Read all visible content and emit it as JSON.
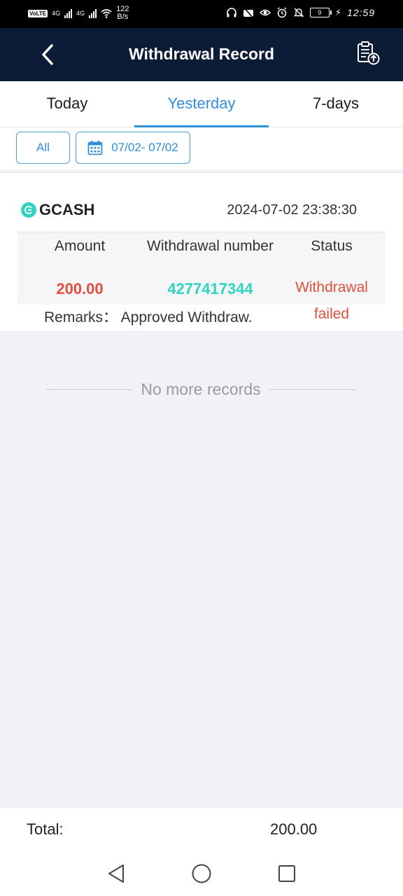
{
  "status_bar": {
    "volte": "VoLTE",
    "net1": "4G",
    "net2": "4G",
    "speed_value": "122",
    "speed_unit": "B/s",
    "battery": "9",
    "time": "12:59"
  },
  "header": {
    "title": "Withdrawal Record",
    "back_icon": "chevron-left-icon",
    "export_icon": "clipboard-upload-icon"
  },
  "tabs": [
    {
      "label": "Today",
      "active": false
    },
    {
      "label": "Yesterday",
      "active": true
    },
    {
      "label": "7-days",
      "active": false
    }
  ],
  "filters": {
    "all_label": "All",
    "date_range": "07/02- 07/02"
  },
  "record": {
    "method": "GCASH",
    "datetime": "2024-07-02 23:38:30",
    "columns": {
      "amount": "Amount",
      "number": "Withdrawal number",
      "status": "Status"
    },
    "amount": "200.00",
    "withdrawal_number": "4277417344",
    "status_line1": "Withdrawal",
    "status_line2": "failed",
    "remarks": "Remarks： Approved Withdraw."
  },
  "no_more": "No more records",
  "footer": {
    "total_label": "Total:",
    "total_value": "200.00"
  },
  "colors": {
    "header_bg": "#0c1c36",
    "accent": "#2f8fd8",
    "amount": "#e0503a",
    "number": "#2fd4c0"
  }
}
